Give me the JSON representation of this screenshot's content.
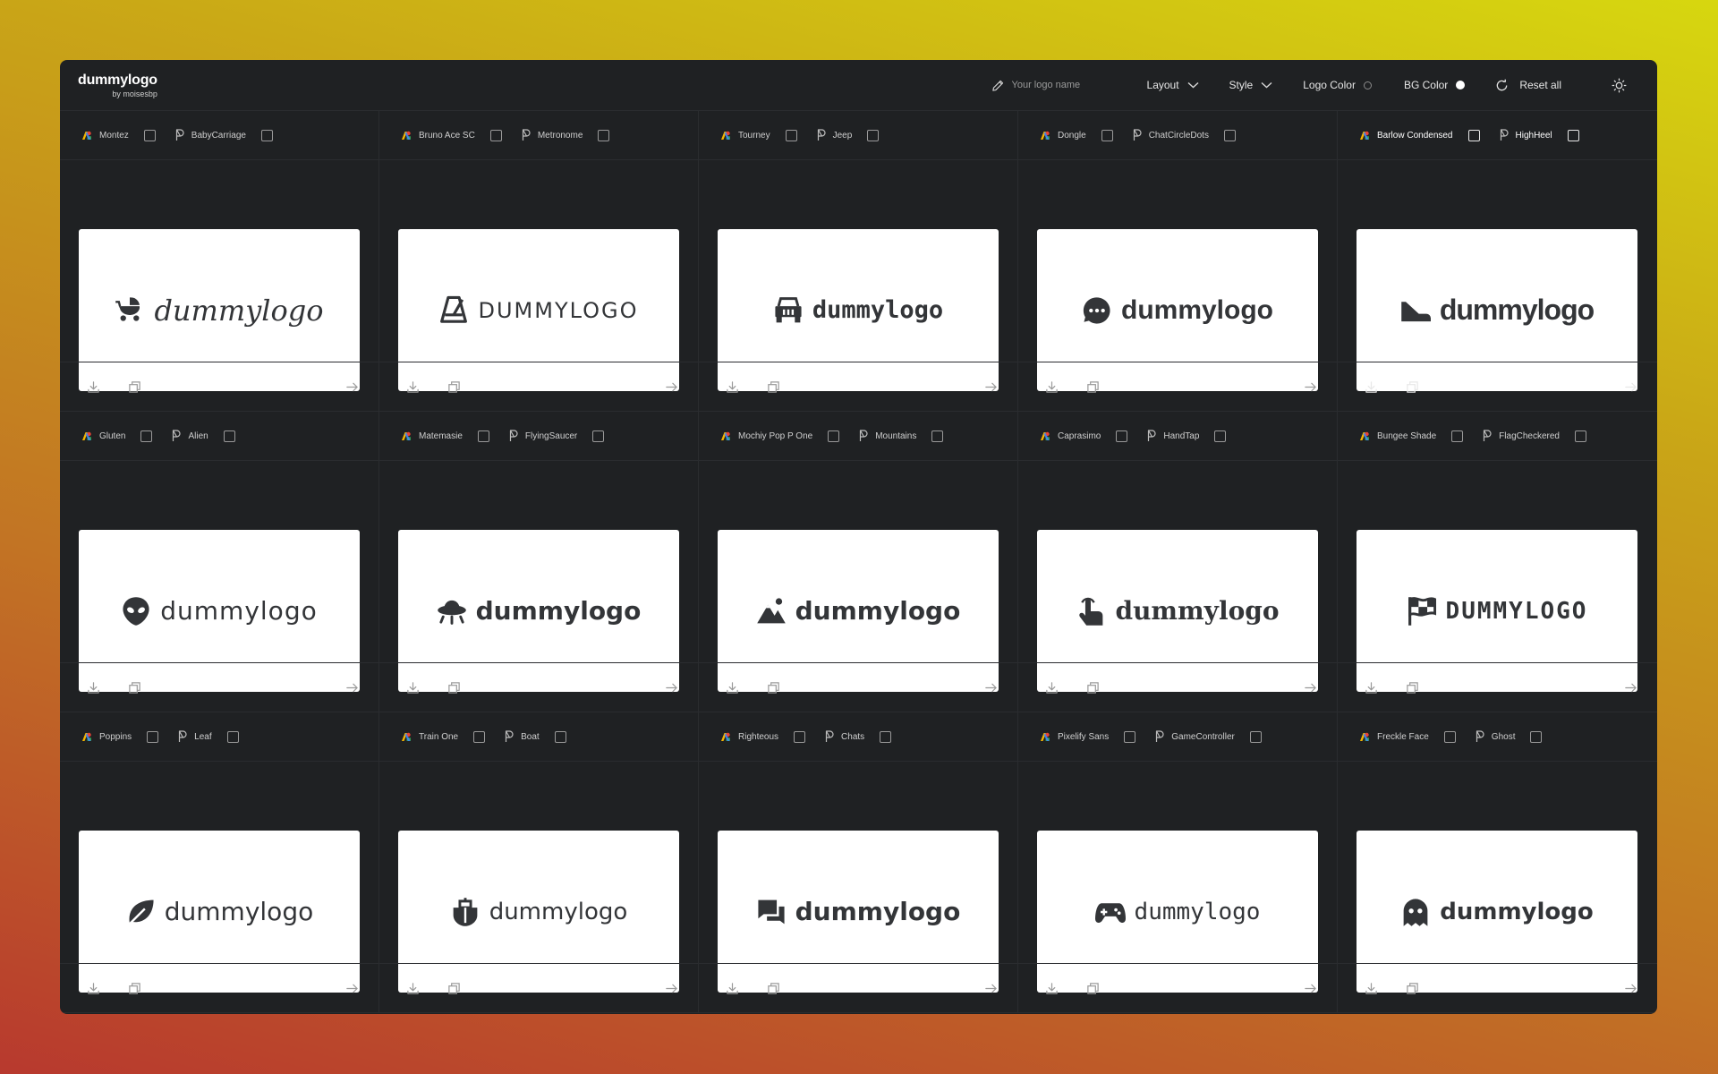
{
  "app": {
    "brand": "dummylogo",
    "brand_by": "by moisesbp"
  },
  "header": {
    "logo_name_placeholder": "Your logo name",
    "layout_label": "Layout",
    "style_label": "Style",
    "logo_color_label": "Logo Color",
    "bg_color_label": "BG Color",
    "reset_label": "Reset all"
  },
  "cards": [
    {
      "font": "Montez",
      "icon": "BabyCarriage",
      "logo_text": "dummylogo",
      "icon_name": "baby-carriage-icon"
    },
    {
      "font": "Bruno Ace SC",
      "icon": "Metronome",
      "logo_text": "DUMMYLOGO",
      "icon_name": "metronome-icon"
    },
    {
      "font": "Tourney",
      "icon": "Jeep",
      "logo_text": "dummylogo",
      "icon_name": "jeep-icon"
    },
    {
      "font": "Dongle",
      "icon": "ChatCircleDots",
      "logo_text": "dummylogo",
      "icon_name": "chat-circle-dots-icon"
    },
    {
      "font": "Barlow Condensed",
      "icon": "HighHeel",
      "logo_text": "dummylogo",
      "icon_name": "high-heel-icon",
      "active": true
    },
    {
      "font": "Gluten",
      "icon": "Alien",
      "logo_text": "dummylogo",
      "icon_name": "alien-icon"
    },
    {
      "font": "Matemasie",
      "icon": "FlyingSaucer",
      "logo_text": "dummylogo",
      "icon_name": "flying-saucer-icon"
    },
    {
      "font": "Mochiy Pop P One",
      "icon": "Mountains",
      "logo_text": "dummylogo",
      "icon_name": "mountains-icon"
    },
    {
      "font": "Caprasimo",
      "icon": "HandTap",
      "logo_text": "dummylogo",
      "icon_name": "hand-tap-icon"
    },
    {
      "font": "Bungee Shade",
      "icon": "FlagCheckered",
      "logo_text": "DUMMYLOGO",
      "icon_name": "flag-checkered-icon"
    },
    {
      "font": "Poppins",
      "icon": "Leaf",
      "logo_text": "dummylogo",
      "icon_name": "leaf-icon"
    },
    {
      "font": "Train One",
      "icon": "Boat",
      "logo_text": "dummylogo",
      "icon_name": "boat-icon"
    },
    {
      "font": "Righteous",
      "icon": "Chats",
      "logo_text": "dummylogo",
      "icon_name": "chats-icon"
    },
    {
      "font": "Pixelify Sans",
      "icon": "GameController",
      "logo_text": "dummylogo",
      "icon_name": "game-controller-icon"
    },
    {
      "font": "Freckle Face",
      "icon": "Ghost",
      "logo_text": "dummylogo",
      "icon_name": "ghost-icon"
    }
  ]
}
